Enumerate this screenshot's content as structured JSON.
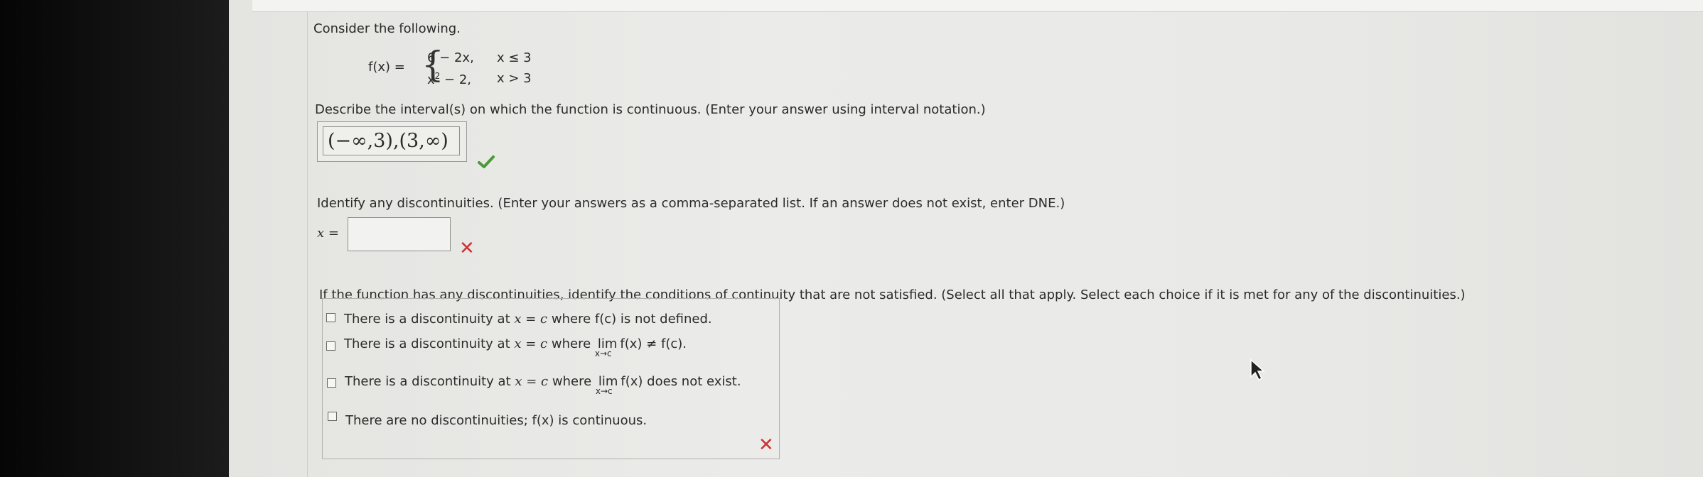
{
  "intro": "Consider the following.",
  "function": {
    "lhs": "f(x) =",
    "case1_expr": "6 − 2x,",
    "case1_cond": "x ≤ 3",
    "case2_expr_base": "x",
    "case2_expr_exp": "2",
    "case2_expr_rest": " − 2,",
    "case2_cond": "x > 3"
  },
  "q1": {
    "prompt": "Describe the interval(s) on which the function is continuous. (Enter your answer using interval notation.)",
    "answer": "(−∞,3),(3,∞)",
    "status": "correct"
  },
  "q2": {
    "prompt": "Identify any discontinuities. (Enter your answers as a comma-separated list. If an answer does not exist, enter DNE.)",
    "label": "x =",
    "value": "",
    "status": "incorrect"
  },
  "q3": {
    "prompt": "If the function has any discontinuities, identify the conditions of continuity that are not satisfied. (Select all that apply. Select each choice if it is met for any of the discontinuities.)",
    "options": [
      {
        "pre": "There is a discontinuity at ",
        "var": "x = c",
        "mid": " where ",
        "tail": "f(c) is not defined.",
        "checked": false
      },
      {
        "pre": "There is a discontinuity at ",
        "var": "x = c",
        "mid": " where ",
        "lim": "lim",
        "limsub": "x→c",
        "tail": "f(x) ≠ f(c).",
        "checked": false
      },
      {
        "pre": "There is a discontinuity at ",
        "var": "x = c",
        "mid": " where ",
        "lim": "lim",
        "limsub": "x→c",
        "tail": "f(x) does not exist.",
        "checked": false
      },
      {
        "pre": "There are no discontinuities; ",
        "tail": "f(x) is continuous.",
        "checked": false
      }
    ],
    "status": "incorrect"
  },
  "marks": {
    "correct": "✔",
    "incorrect": "✕"
  },
  "colors": {
    "correct": "#4a9a3a",
    "incorrect": "#cc3333"
  }
}
